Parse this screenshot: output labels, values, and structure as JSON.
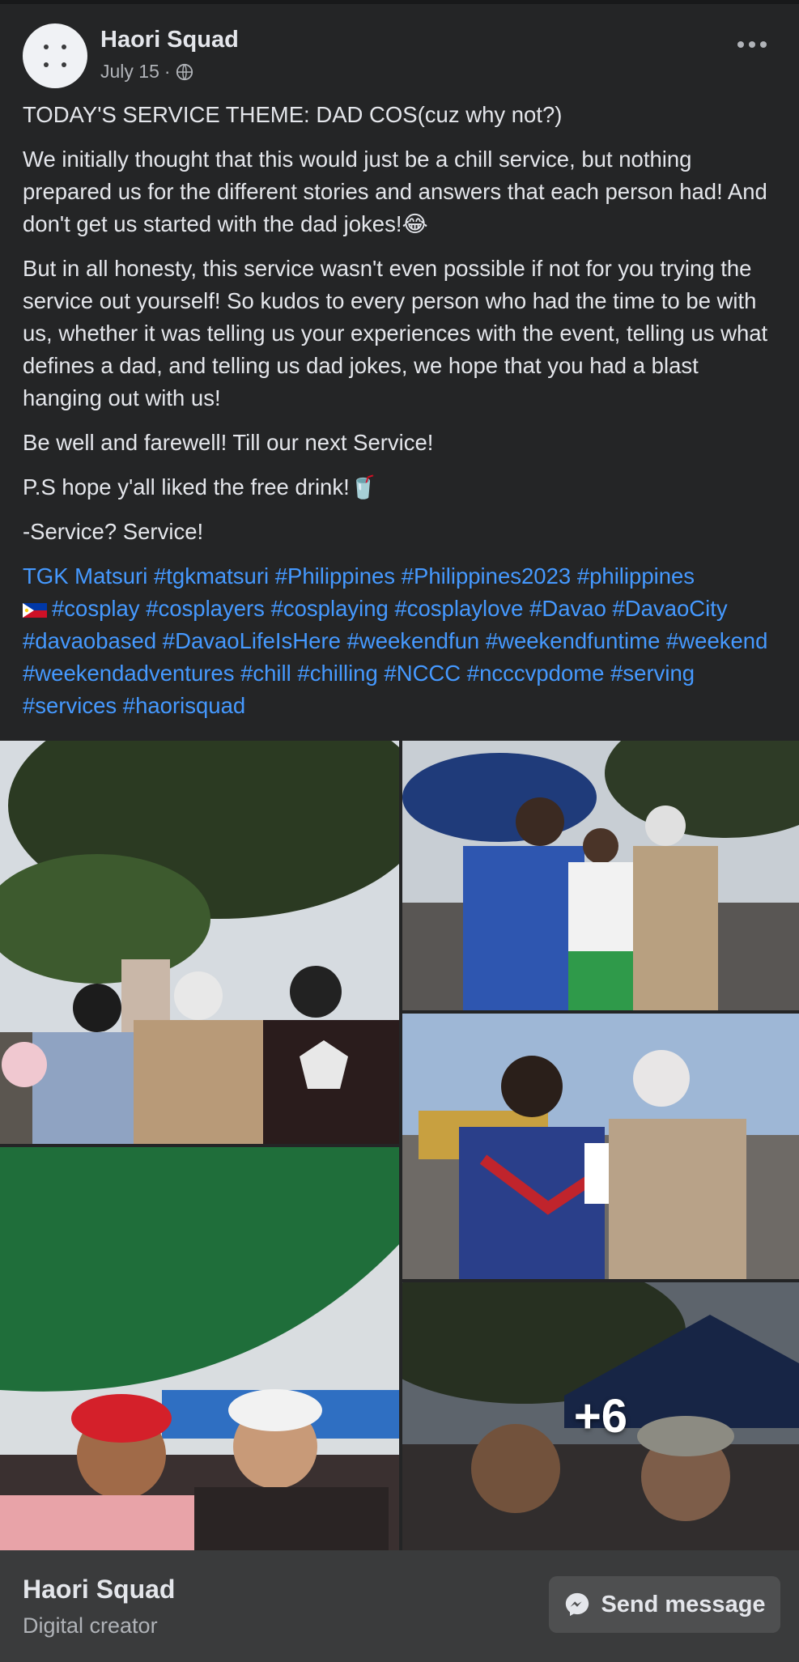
{
  "post": {
    "author": "Haori Squad",
    "date": "July 15",
    "separator": "·",
    "privacy_icon": "globe-icon",
    "more_icon": "more-options-icon"
  },
  "content": {
    "paragraphs": [
      "TODAY'S SERVICE THEME: DAD COS(cuz why not?)",
      "We initially thought that this would just be a chill service, but nothing prepared us for the different stories and answers that each person had! And don't get us started with the dad jokes!😂",
      "But in all honesty, this service wasn't even possible if not for you trying the service out yourself! So kudos to every person who had the time to be with us, whether it was telling us your experiences with the event, telling us what defines a dad, and telling us dad jokes, we hope that you had a blast hanging out with us!",
      "Be well and farewell! Till our next Service!",
      "P.S hope y'all liked the free drink!🥤",
      "-Service? Service!"
    ],
    "hashtags_line1": [
      "TGK Matsuri",
      "#tgkmatsuri",
      "#Philippines",
      "#Philippines2023",
      "#philippines"
    ],
    "hashtags_rest": [
      "#cosplay",
      "#cosplayers",
      "#cosplaying",
      "#cosplaylove",
      "#Davao",
      "#DavaoCity",
      "#davaobased",
      "#DavaoLifeIsHere",
      "#weekendfun",
      "#weekendfuntime",
      "#weekend",
      "#weekendadventures",
      "#chill",
      "#chilling",
      "#NCCC",
      "#ncccvpdome",
      "#serving",
      "#services",
      "#haorisquad"
    ]
  },
  "gallery": {
    "more_count": "+6"
  },
  "footer": {
    "name": "Haori Squad",
    "category": "Digital creator",
    "send_label": "Send message",
    "send_icon": "messenger-icon"
  },
  "colors": {
    "background": "#242526",
    "footer": "#3a3b3c",
    "link": "#4599ff",
    "text": "#e4e6eb",
    "muted": "#b0b3b8"
  }
}
